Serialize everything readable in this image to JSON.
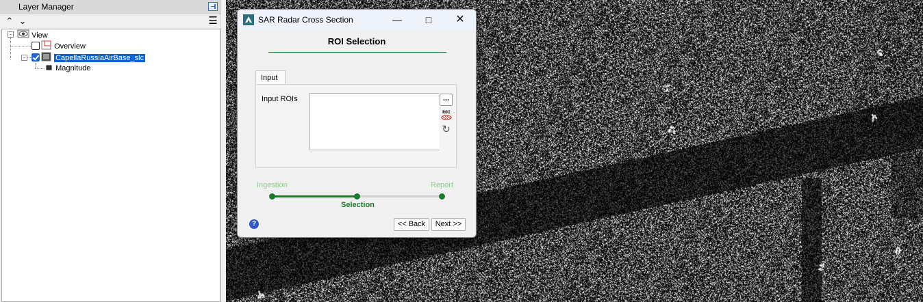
{
  "layer_manager": {
    "title": "Layer Manager",
    "toolbar": {
      "up_icon": "chevron-up-icon",
      "down_icon": "chevron-down-icon",
      "menu_icon": "menu-icon"
    },
    "tree": {
      "root": {
        "label": "View",
        "icon": "view-eye-icon"
      },
      "children": [
        {
          "label": "Overview",
          "checked": false,
          "icon": "overview-icon"
        },
        {
          "label": "CapellaRussiaAirBase_slc",
          "checked": true,
          "selected": true,
          "icon": "raster-icon",
          "children": [
            {
              "label": "Magnitude",
              "icon": "layer-icon"
            }
          ]
        }
      ]
    }
  },
  "dialog": {
    "title": "SAR Radar Cross Section",
    "heading": "ROI Selection",
    "tab_label": "Input",
    "input_rois_label": "Input ROIs",
    "browse_label": "...",
    "roi_button_text": "ROI",
    "steps": {
      "first": "Ingestion",
      "current": "Selection",
      "last": "Report"
    },
    "progress_fraction": 0.5,
    "back_label": "<< Back",
    "next_label": "Next >>",
    "colors": {
      "accent_green": "#1b7a2a",
      "inactive_step": "#8fc98f",
      "help_blue": "#2f58c8"
    }
  }
}
